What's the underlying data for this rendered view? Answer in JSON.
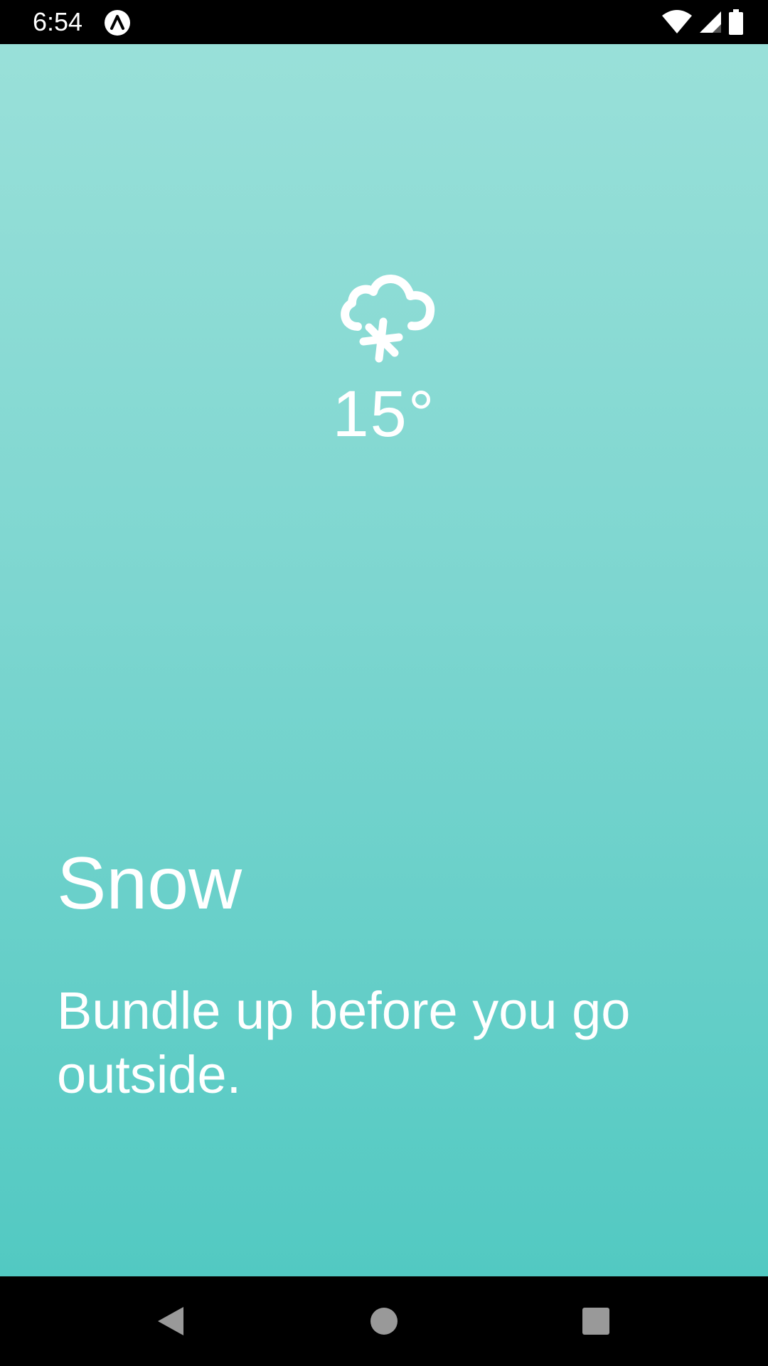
{
  "status_bar": {
    "time": "6:54",
    "app_icon": "expo-app-icon",
    "icons": [
      "wifi-icon",
      "cellular-signal-icon",
      "battery-icon"
    ]
  },
  "weather": {
    "icon": "cloud-snow-icon",
    "temperature": "15°",
    "title": "Snow",
    "message": "Bundle up before you go outside."
  },
  "nav_bar": {
    "icons": [
      "back-icon",
      "home-icon",
      "recents-icon"
    ]
  },
  "colors": {
    "background_top": "#99e0d9",
    "background_bottom": "#52c9c2",
    "text": "#ffffff",
    "bars": "#000000"
  }
}
